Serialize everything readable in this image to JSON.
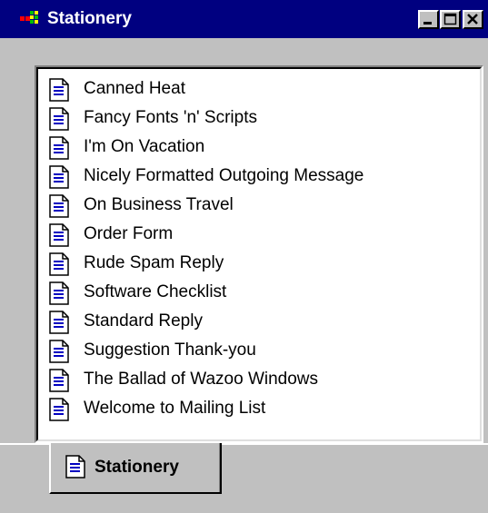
{
  "window": {
    "title": "Stationery",
    "controls": {
      "minimize_icon": "minimize-icon",
      "maximize_icon": "maximize-icon",
      "close_icon": "close-icon"
    },
    "titlebar_color": "#000080",
    "background_color": "#c0c0c0"
  },
  "list": {
    "item_icon": "document-icon",
    "items": [
      {
        "label": "Canned Heat"
      },
      {
        "label": "Fancy Fonts 'n' Scripts"
      },
      {
        "label": "I'm On Vacation"
      },
      {
        "label": "Nicely Formatted Outgoing Message"
      },
      {
        "label": "On Business Travel"
      },
      {
        "label": "Order Form"
      },
      {
        "label": "Rude Spam Reply"
      },
      {
        "label": "Software Checklist"
      },
      {
        "label": "Standard Reply"
      },
      {
        "label": "Suggestion Thank-you"
      },
      {
        "label": "The Ballad of Wazoo Windows"
      },
      {
        "label": "Welcome to Mailing List"
      }
    ]
  },
  "tabs": [
    {
      "label": "Stationery",
      "icon": "document-icon",
      "selected": true
    }
  ]
}
